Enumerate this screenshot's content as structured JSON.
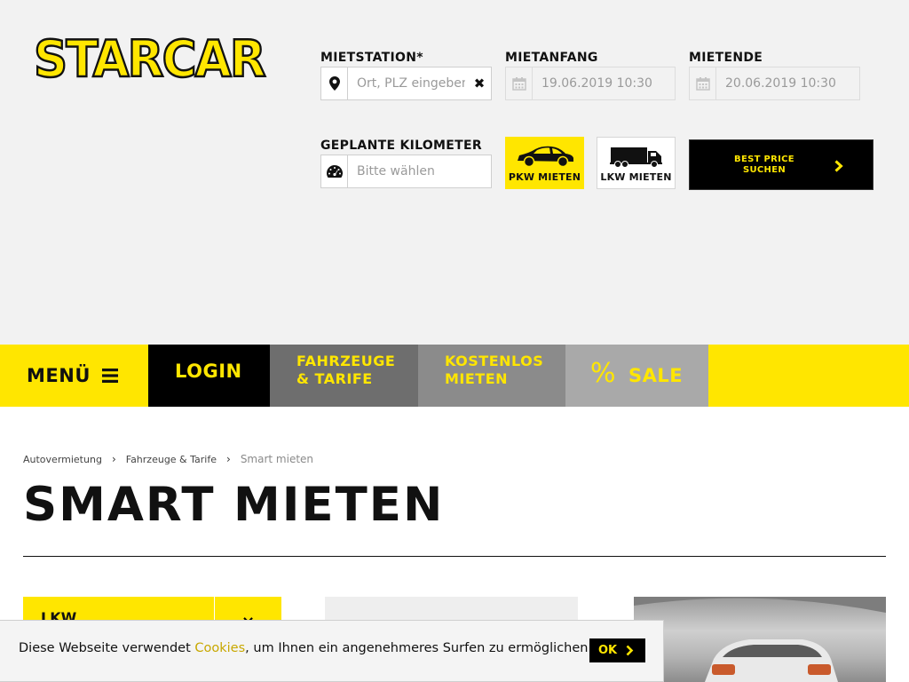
{
  "brand": {
    "name": "STARCAR",
    "accent": "#ffe600"
  },
  "booking": {
    "station_label": "MIETSTATION*",
    "station_placeholder": "Ort, PLZ eingeben",
    "start_label": "MIETANFANG",
    "start_value": "19.06.2019 10:30",
    "end_label": "MIETENDE",
    "end_value": "20.06.2019 10:30",
    "km_label": "GEPLANTE KILOMETER",
    "km_placeholder": "Bitte wählen",
    "pkw_label": "PKW MIETEN",
    "lkw_label": "LKW MIETEN",
    "search_line1": "BEST PRICE",
    "search_line2": "SUCHEN"
  },
  "nav": {
    "menu": "MENÜ",
    "login": "LOGIN",
    "fahrzeuge_line1": "FAHRZEUGE",
    "fahrzeuge_line2": "& TARIFE",
    "kostenlos_line1": "KOSTENLOS",
    "kostenlos_line2": "MIETEN",
    "sale_icon": "%",
    "sale": "SALE"
  },
  "breadcrumb": [
    "Autovermietung",
    "Fahrzeuge & Tarife",
    "Smart mieten"
  ],
  "page": {
    "title": "SMART MIETEN"
  },
  "filter": {
    "lkw_label": "LKW",
    "toggle_icon": "×"
  },
  "cookie": {
    "text_before": "Diese Webseite verwendet ",
    "link": "Cookies",
    "text_after": ", um Ihnen ein angenehmeres Surfen zu ermöglichen.",
    "ok": "OK"
  },
  "icons": {
    "station": "map-pin-icon",
    "clear": "close-icon",
    "calendar": "calendar-icon",
    "km": "speedometer-icon",
    "pkw": "car-icon",
    "lkw": "truck-icon",
    "menu": "hamburger-icon",
    "chevron": "chevron-right-icon"
  }
}
